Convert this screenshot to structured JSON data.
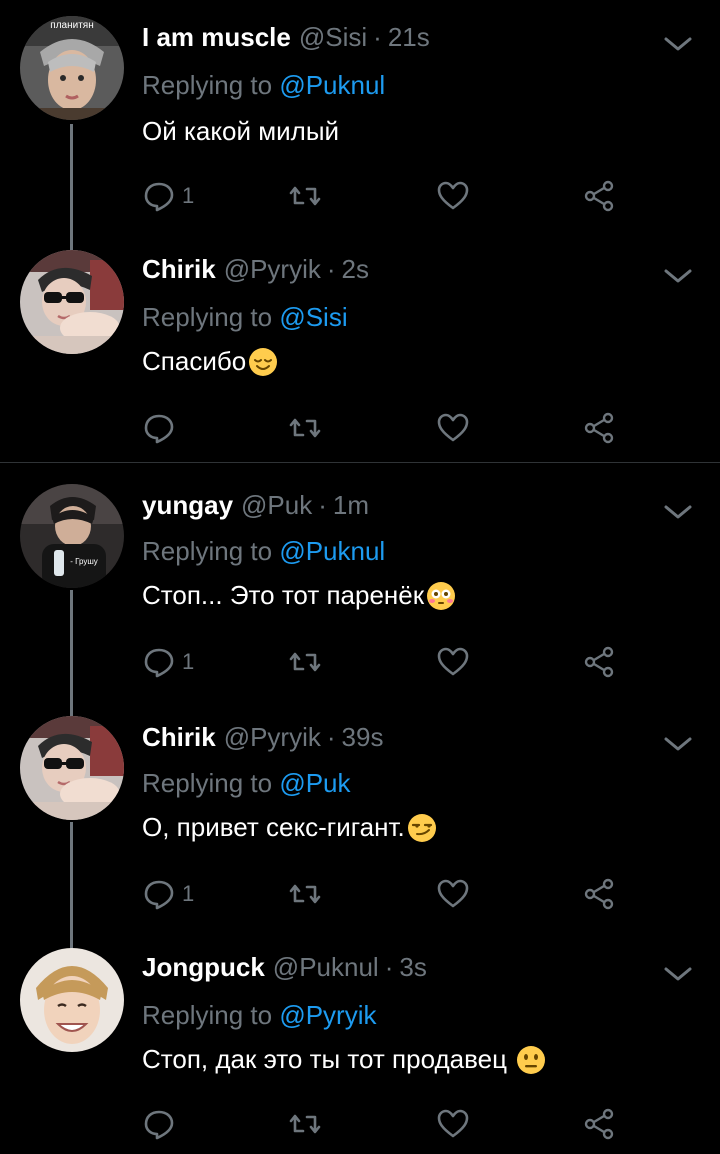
{
  "replying_label": "Replying to",
  "tweets": [
    {
      "name": "I am muscle",
      "handle": "@Sisi",
      "time": "21s",
      "reply_to": "@Puknul",
      "text": "Ой какой милый",
      "emoji": "",
      "reply_count": "1",
      "avatar_caption": "планитян"
    },
    {
      "name": "Chirik",
      "handle": "@Pyryik",
      "time": "2s",
      "reply_to": "@Sisi",
      "text": "Спасибо",
      "emoji": "relieved-face",
      "reply_count": "",
      "avatar_caption": ""
    },
    {
      "name": "yungay",
      "handle": "@Puk",
      "time": "1m",
      "reply_to": "@Puknul",
      "text": "Стоп... Это тот паренёк",
      "emoji": "flushed-face",
      "reply_count": "1",
      "avatar_caption": "- Грушу"
    },
    {
      "name": "Chirik",
      "handle": "@Pyryik",
      "time": "39s",
      "reply_to": "@Puk",
      "text": "О, привет секс-гигант.",
      "emoji": "smirking-face",
      "reply_count": "1",
      "avatar_caption": ""
    },
    {
      "name": "Jongpuck",
      "handle": "@Puknul",
      "time": "3s",
      "reply_to": "@Pyryik",
      "text": "Стоп, дак это ты тот продавец ",
      "emoji": "neutral-face",
      "reply_count": "",
      "avatar_caption": ""
    }
  ],
  "colors": {
    "background": "#000000",
    "secondary_text": "#6e767d",
    "mention": "#1d9bf0",
    "emoji_yellow": "#ffcc4d"
  }
}
